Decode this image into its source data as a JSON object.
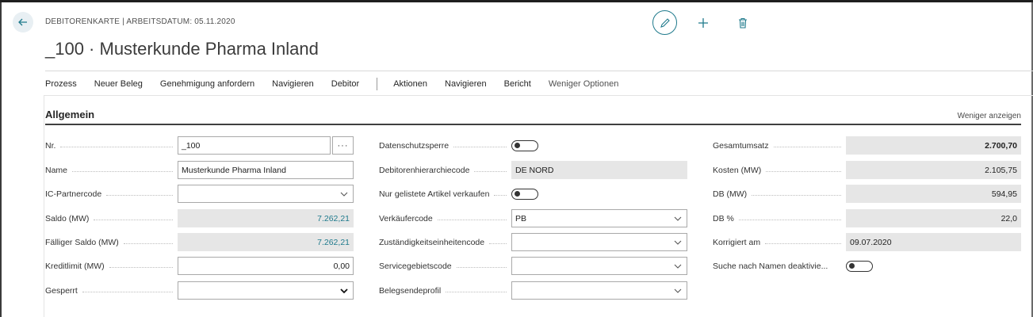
{
  "header": {
    "caption": "DEBITORENKARTE | ARBEITSDATUM: 05.11.2020",
    "title": "_100 · Musterkunde Pharma Inland"
  },
  "menu": {
    "primary": [
      "Prozess",
      "Neuer Beleg",
      "Genehmigung anfordern",
      "Navigieren",
      "Debitor"
    ],
    "secondary": [
      "Aktionen",
      "Navigieren",
      "Bericht",
      "Weniger Optionen"
    ]
  },
  "section": {
    "title": "Allgemein",
    "less_link": "Weniger anzeigen"
  },
  "col1": {
    "nr_label": "Nr.",
    "nr_value": "_100",
    "nr_assist": "···",
    "name_label": "Name",
    "name_value": "Musterkunde Pharma Inland",
    "ic_label": "IC-Partnercode",
    "ic_value": "",
    "saldo_label": "Saldo (MW)",
    "saldo_value": "7.262,21",
    "faellig_label": "Fälliger Saldo (MW)",
    "faellig_value": "7.262,21",
    "kredit_label": "Kreditlimit (MW)",
    "kredit_value": "0,00",
    "gesperrt_label": "Gesperrt",
    "gesperrt_value": ""
  },
  "col2": {
    "datenschutz_label": "Datenschutzsperre",
    "datenschutz_on": false,
    "hier_label": "Debitorenhierarchiecode",
    "hier_value": "DE NORD",
    "gelistet_label": "Nur gelistete Artikel verkaufen",
    "gelistet_on": false,
    "verkaeufer_label": "Verkäufercode",
    "verkaeufer_value": "PB",
    "zust_label": "Zuständigkeitseinheitencode",
    "zust_value": "",
    "service_label": "Servicegebietscode",
    "service_value": "",
    "beleg_label": "Belegsendeprofil",
    "beleg_value": ""
  },
  "col3": {
    "umsatz_label": "Gesamtumsatz",
    "umsatz_value": "2.700,70",
    "kosten_label": "Kosten (MW)",
    "kosten_value": "2.105,75",
    "db_label": "DB (MW)",
    "db_value": "594,95",
    "dbp_label": "DB %",
    "dbp_value": "22,0",
    "korr_label": "Korrigiert am",
    "korr_value": "09.07.2020",
    "suche_label": "Suche nach Namen deaktivie...",
    "suche_on": false
  },
  "colors": {
    "accent": "#1f7a8c",
    "readonly_bg": "#e6e6e6"
  }
}
